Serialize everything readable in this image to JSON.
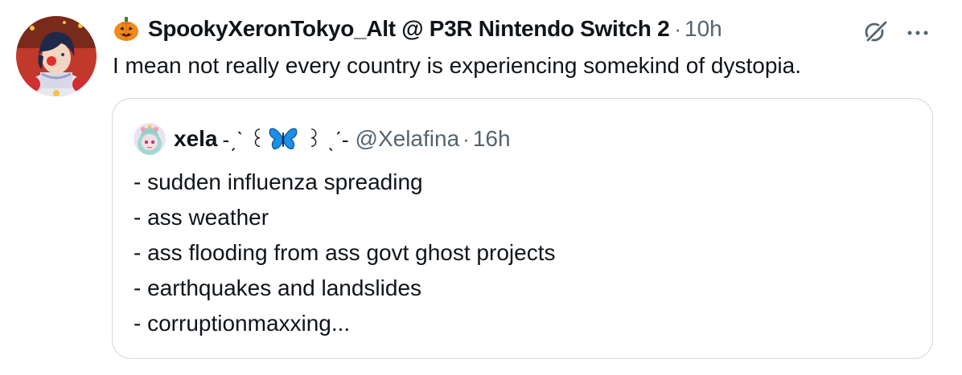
{
  "tweet": {
    "avatar_icon": "profile-avatar-clown-character",
    "name_emoji": "jack-o-lantern-icon",
    "display_name": "SpookyXeronTokyo_Alt @ P3R Nintendo Switch 2",
    "separator": "·",
    "timestamp": "10h",
    "text": "I mean not really every country is experiencing somekind of dystopia.",
    "actions": {
      "grok_icon": "grok-icon",
      "more_icon": "more-icon"
    }
  },
  "quote": {
    "avatar_icon": "profile-avatar-anime-girl",
    "display_name": "xela",
    "name_deco_left": "-ˏˋ ꒰",
    "name_emoji": "butterfly-icon",
    "name_deco_right": "꒱ ˎˊ-",
    "handle": "@Xelafina",
    "separator": "·",
    "timestamp": "16h",
    "lines": [
      "- sudden influenza spreading",
      "- ass weather",
      "- ass flooding from ass govt ghost projects",
      "- earthquakes and landslides",
      "- corruptionmaxxing..."
    ]
  },
  "colors": {
    "text": "#0f1419",
    "secondary": "#536471",
    "border": "#cfd9de",
    "butterfly": "#1d8fe6"
  }
}
